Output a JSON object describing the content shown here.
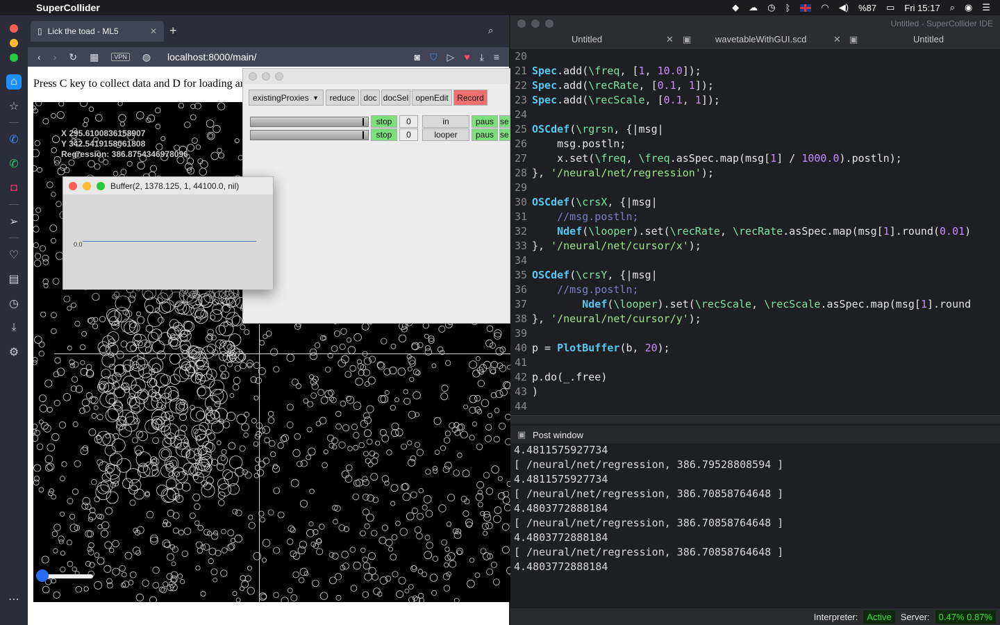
{
  "menubar": {
    "app": "SuperCollider",
    "battery": "%87",
    "clock": "Fri 15:17"
  },
  "sidebar": {
    "accent": "#1e90ff"
  },
  "browser": {
    "tab_title": "Lick the toad - ML5",
    "url": "localhost:8000/main/",
    "vpn": "VPN",
    "instructions": "Press C key to collect data and D for loading ar",
    "readout": [
      "X 295.6100836158907",
      "Y 342.5419158061808",
      "Regression: 386.8754346978096"
    ]
  },
  "gui": {
    "dropdown": "existingProxies",
    "buttons": [
      "reduce",
      "doc",
      "docSel",
      "openEdit"
    ],
    "record": "Record",
    "rows": [
      {
        "stop": "stop",
        "count": "0",
        "name": "in",
        "pause": "paus",
        "send": "se"
      },
      {
        "stop": "stop",
        "count": "0",
        "name": "looper",
        "pause": "paus",
        "send": "se"
      }
    ]
  },
  "buffer": {
    "title": "Buffer(2, 1378.125, 1, 44100.0, nil)",
    "zero_label": "0.0"
  },
  "ide": {
    "title": "Untitled - SuperCollider IDE",
    "tabs": [
      "Untitled",
      "wavetableWithGUI.scd",
      "Untitled"
    ],
    "post_title": "Post window",
    "post_lines": [
      "4.4811575927734",
      "[ /neural/net/regression, 386.79528808594 ]",
      "4.4811575927734",
      "[ /neural/net/regression, 386.70858764648 ]",
      "4.4803772888184",
      "[ /neural/net/regression, 386.70858764648 ]",
      "4.4803772888184",
      "[ /neural/net/regression, 386.70858764648 ]",
      "4.4803772888184"
    ],
    "interpreter_label": "Interpreter:",
    "interpreter_status": "Active",
    "server_label": "Server:",
    "server_cpu": "0.47% 0.87%"
  }
}
